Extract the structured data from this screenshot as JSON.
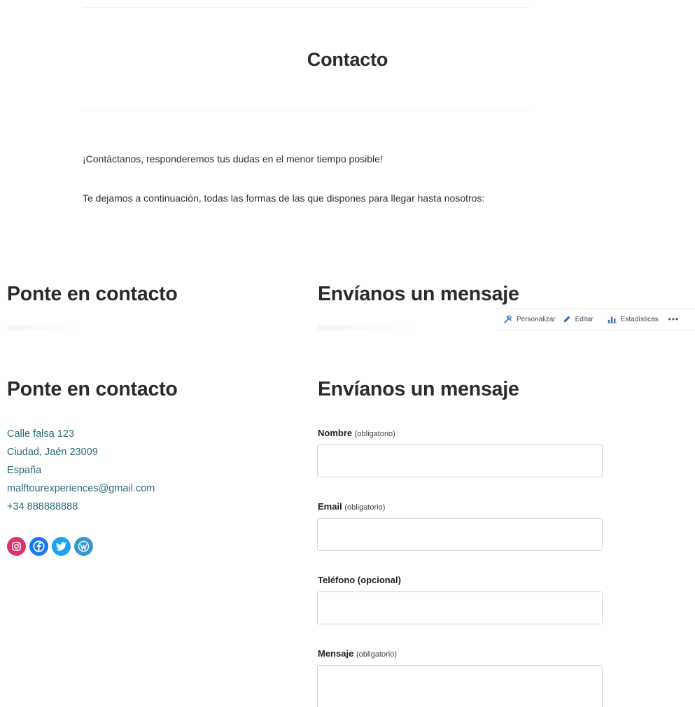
{
  "page": {
    "title": "Contacto",
    "intro_1": "¡Contáctanos, responderemos tus dudas en el menor tiempo posible!",
    "intro_2": "Te dejamos a continuación, todas las formas de las que dispones para llegar hasta nosotros:"
  },
  "preview": {
    "left_heading": "Ponte en contacto",
    "right_heading": "Envíanos un mensaje"
  },
  "admin_bar": {
    "customize_label": "Personalizar",
    "edit_label": "Editar",
    "stats_label": "Estadísticas",
    "more_label": "•••"
  },
  "contact": {
    "heading": "Ponte en contacto",
    "address_1": "Calle falsa 123",
    "address_2": "Ciudad, Jaén 23009",
    "country": "España",
    "email": "malftourexperiences@gmail.com",
    "phone": "+34 888888888",
    "social": [
      {
        "icon": "instagram-icon",
        "color": "#e1306c"
      },
      {
        "icon": "facebook-icon",
        "color": "#1877f2"
      },
      {
        "icon": "twitter-icon",
        "color": "#1da1f2"
      },
      {
        "icon": "wordpress-icon",
        "color": "#3499cd"
      }
    ]
  },
  "form": {
    "heading": "Envíanos un mensaje",
    "name_label": "Nombre",
    "name_req": "(obligatorio)",
    "name_value": "",
    "email_label": "Email",
    "email_req": "(obligatorio)",
    "email_value": "",
    "phone_label": "Teléfono (opcional)",
    "phone_value": "",
    "message_label": "Mensaje",
    "message_req": "(obligatorio)",
    "message_value": ""
  }
}
